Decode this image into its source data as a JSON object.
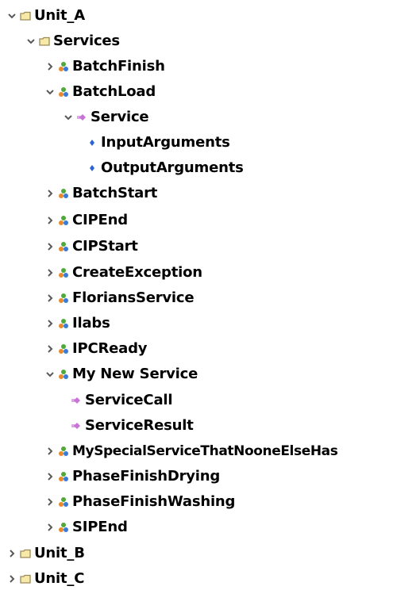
{
  "tree": {
    "unit_a": "Unit_A",
    "services": "Services",
    "batch_finish": "BatchFinish",
    "batch_load": "BatchLoad",
    "service": "Service",
    "input_arguments": "InputArguments",
    "output_arguments": "OutputArguments",
    "batch_start": "BatchStart",
    "cip_end": "CIPEnd",
    "cip_start": "CIPStart",
    "create_exception": "CreateException",
    "florians_service": "FloriansService",
    "ilabs": "Ilabs",
    "ipc_ready": "IPCReady",
    "my_new_service": "My New Service",
    "service_call": "ServiceCall",
    "service_result": "ServiceResult",
    "my_special_service": "MySpecialServiceThatNooneElseHas",
    "phase_finish_drying": "PhaseFinishDrying",
    "phase_finish_washing": "PhaseFinishWashing",
    "sip_end": "SIPEnd",
    "unit_b": "Unit_B",
    "unit_c": "Unit_C"
  },
  "icons": {
    "folder": "folder-icon",
    "service_group": "service-group-icon",
    "method": "method-icon",
    "argument": "argument-icon",
    "expanded": "chevron-down-icon",
    "collapsed": "chevron-right-icon"
  },
  "colors": {
    "chevron": "#5a5a5a",
    "folder_stroke": "#9a8a5a",
    "folder_fill": "#f7e9a8",
    "method": "#c873d6",
    "argument": "#2b66d9",
    "group_green": "#4fa93a",
    "group_orange": "#e8892a",
    "group_blue": "#3a7bd5"
  }
}
